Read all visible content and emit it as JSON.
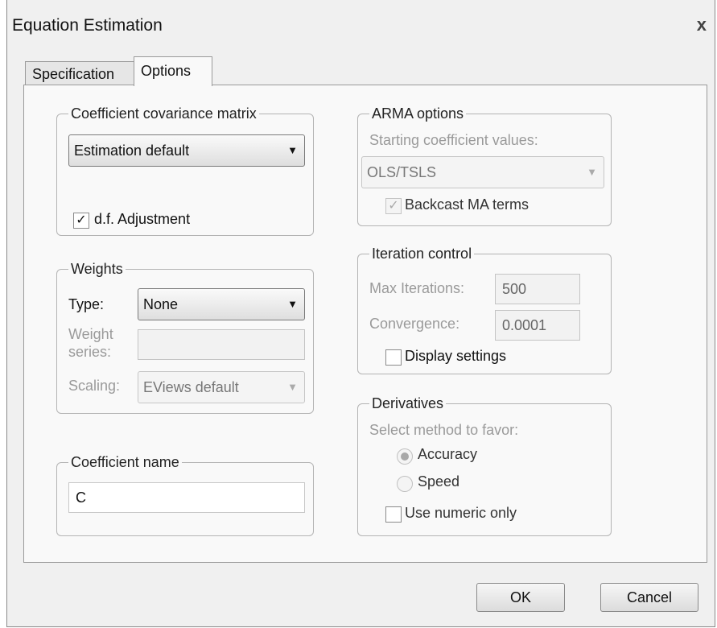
{
  "window": {
    "title": "Equation Estimation",
    "close_glyph": "x"
  },
  "tabs": [
    {
      "label": "Specification",
      "active": false
    },
    {
      "label": "Options",
      "active": true
    }
  ],
  "covariance": {
    "legend": "Coefficient covariance matrix",
    "selected": "Estimation default",
    "df_adjustment": {
      "label": "d.f. Adjustment",
      "checked": true
    }
  },
  "weights": {
    "legend": "Weights",
    "type_label": "Type:",
    "type_value": "None",
    "weight_series_label_line1": "Weight",
    "weight_series_label_line2": "series:",
    "weight_series_value": "",
    "scaling_label": "Scaling:",
    "scaling_value": "EViews default"
  },
  "coef_name": {
    "legend": "Coefficient name",
    "value": "C"
  },
  "arma": {
    "legend": "ARMA options",
    "start_label": "Starting coefficient values:",
    "start_value": "OLS/TSLS",
    "backcast": {
      "label": "Backcast MA terms",
      "checked": true
    }
  },
  "iteration": {
    "legend": "Iteration control",
    "max_label": "Max Iterations:",
    "max_value": "500",
    "conv_label": "Convergence:",
    "conv_value": "0.0001",
    "display": {
      "label": "Display settings",
      "checked": false
    }
  },
  "derivatives": {
    "legend": "Derivatives",
    "select_label": "Select method to favor:",
    "accuracy_label": "Accuracy",
    "speed_label": "Speed",
    "selected": "Accuracy",
    "numeric": {
      "label": "Use numeric only",
      "checked": false
    }
  },
  "buttons": {
    "ok": "OK",
    "cancel": "Cancel"
  }
}
